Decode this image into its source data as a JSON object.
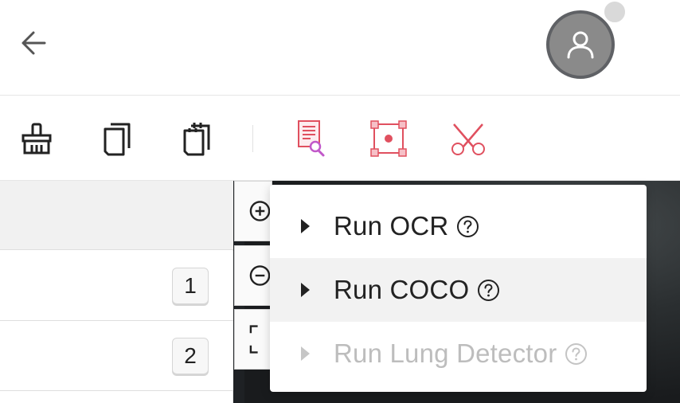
{
  "header": {
    "back_icon": "arrow-left-icon",
    "avatar_icon": "user-icon",
    "status_color": "#d9d9d9"
  },
  "toolbar": {
    "tools": [
      {
        "name": "clean-tool",
        "icon": "broom-icon"
      },
      {
        "name": "copy-tool",
        "icon": "copy-icon"
      },
      {
        "name": "paste-tool",
        "icon": "paste-icon"
      },
      {
        "name": "ocr-tool",
        "icon": "document-search-icon"
      },
      {
        "name": "detect-tool",
        "icon": "bounding-box-icon"
      },
      {
        "name": "cut-tool",
        "icon": "scissors-icon"
      }
    ],
    "accent_color": "#e0505f"
  },
  "list": {
    "rows": [
      {
        "badge": "1"
      },
      {
        "badge": "2"
      }
    ]
  },
  "zoom": {
    "buttons": [
      "zoom-in-icon",
      "zoom-out-icon",
      "fit-screen-icon"
    ]
  },
  "menu": {
    "items": [
      {
        "label": "Run OCR",
        "state": "normal"
      },
      {
        "label": "Run COCO",
        "state": "hover"
      },
      {
        "label": "Run Lung Detector",
        "state": "disabled"
      }
    ]
  }
}
